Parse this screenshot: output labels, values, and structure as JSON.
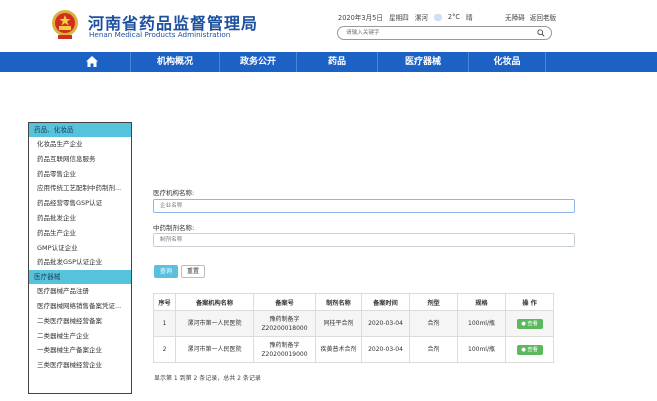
{
  "header": {
    "title": "河南省药品监督管理局",
    "subtitle": "Henan Medical Products Administration",
    "date": "2020年3月5日",
    "weekday": "星期四",
    "city": "漯河",
    "temp": "2°C",
    "weather": "晴",
    "link_barrier_free": "无障碍",
    "link_elder": "返回老版",
    "search_placeholder": "请输入关键字"
  },
  "nav": {
    "items": [
      "机构概况",
      "政务公开",
      "药品",
      "医疗器械",
      "化妆品"
    ]
  },
  "sidebar": {
    "group1_title": "药品、化妆品",
    "group1_items": [
      "化妆品生产企业",
      "药品互联网信息服务",
      "药品零售企业",
      "应用传统工艺配制中药制剂...",
      "药品经营零售GSP认证",
      "药品批发企业",
      "药品生产企业",
      "GMP认证企业",
      "药品批发GSP认证企业"
    ],
    "group2_title": "医疗器械",
    "group2_items": [
      "医疗器械产品注册",
      "医疗器械网络销售备案凭证...",
      "二类医疗器械经营备案",
      "二类器械生产企业",
      "一类器械生产备案企业",
      "三类医疗器械经营企业"
    ]
  },
  "form": {
    "org_label": "医疗机构名称:",
    "org_placeholder": "企业名称",
    "prep_label": "中药制剂名称:",
    "prep_placeholder": "制剂名称",
    "query_btn": "查询",
    "reset_btn": "重置"
  },
  "table": {
    "headers": [
      "序号",
      "备案机构名称",
      "备案号",
      "制剂名称",
      "备案时间",
      "剂型",
      "规格",
      "操 作"
    ],
    "rows": [
      {
        "no": "1",
        "org": "漯河市第一人民医院",
        "reg1": "豫药制备字",
        "reg2": "Z20200018000",
        "name": "同桂平合剂",
        "date": "2020-03-04",
        "form": "合剂",
        "spec": "100ml/瓶",
        "action": "查看"
      },
      {
        "no": "2",
        "org": "漯河市第一人民医院",
        "reg1": "豫药制备字",
        "reg2": "Z20200019000",
        "name": "疾黄普术合剂",
        "date": "2020-03-04",
        "form": "合剂",
        "spec": "100ml/瓶",
        "action": "查看"
      }
    ],
    "summary": "显示第 1 到第 2 条记录，总共 2 条记录"
  },
  "colors": {
    "brand": "#1c4f9e",
    "nav_bg": "#1c61c4",
    "sidebar_head": "#56c3dc",
    "query_btn": "#5bc0de",
    "view_btn": "#5cb85c"
  }
}
